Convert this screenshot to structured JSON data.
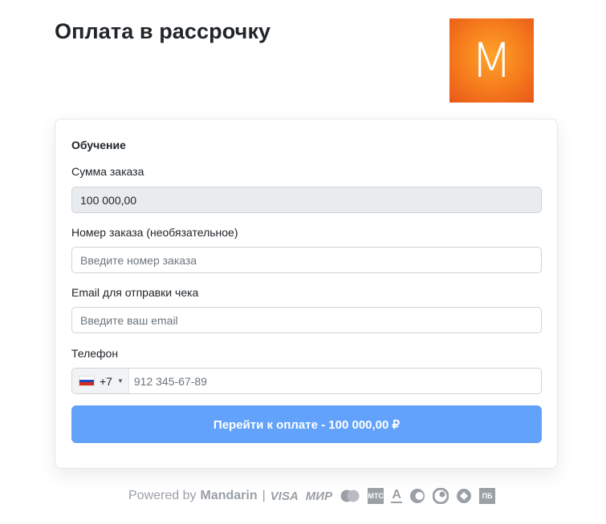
{
  "page": {
    "title": "Оплата в рассрочку",
    "logo_letter": "M"
  },
  "form": {
    "section_title": "Обучение",
    "amount": {
      "label": "Сумма заказа",
      "value": "100 000,00"
    },
    "order_number": {
      "label": "Номер заказа (необязательное)",
      "placeholder": "Введите номер заказа"
    },
    "email": {
      "label": "Email для отправки чека",
      "placeholder": "Введите ваш email"
    },
    "phone": {
      "label": "Телефон",
      "country_code": "+7",
      "country_flag": "russia-flag",
      "placeholder": "912 345-67-89"
    },
    "pay_button_label": "Перейти к оплате - 100 000,00 ₽"
  },
  "footer": {
    "powered_by": "Powered by",
    "brand": "Mandarin",
    "separator": "|",
    "payment_methods": {
      "visa": "VISA",
      "mir": "МИР",
      "mastercard": "mastercard-icon",
      "mts": "МТС",
      "alfa": "A",
      "pb": "ПБ"
    }
  },
  "colors": {
    "button_bg": "#62a2fa",
    "logo_orange": "#f57a1c",
    "readonly_bg": "#e9ecef",
    "footer_gray": "#9aa0a6"
  }
}
